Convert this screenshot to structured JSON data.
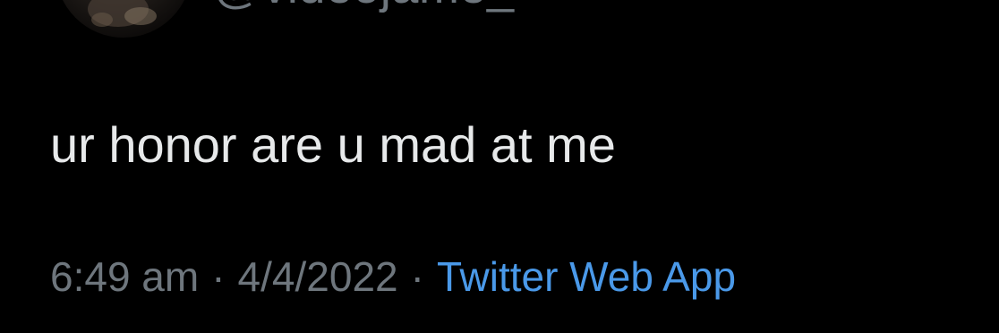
{
  "author": {
    "handle": "@videojame_"
  },
  "tweet": {
    "text": "ur honor are u mad at me",
    "time": "6:49 am",
    "separator": "·",
    "date": "4/4/2022",
    "source": "Twitter Web App"
  },
  "colors": {
    "background": "#000000",
    "text": "#e7e9ea",
    "muted": "#6e767d",
    "link": "#4a99e9"
  }
}
